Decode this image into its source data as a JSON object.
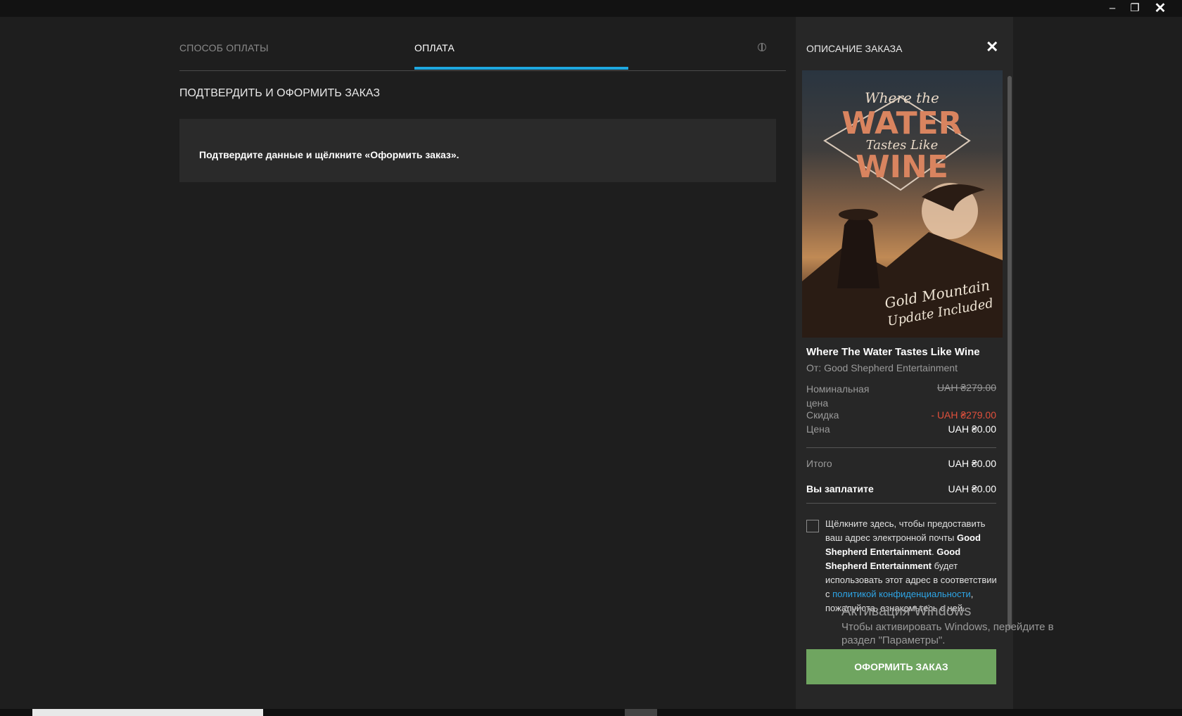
{
  "window": {
    "minimize_glyph": "–",
    "maximize_glyph": "❐",
    "close_glyph": "✕"
  },
  "tabs": [
    {
      "label": "СПОСОБ ОПЛАТЫ",
      "active": false
    },
    {
      "label": "ОПЛАТА",
      "active": true
    }
  ],
  "main": {
    "section_title": "ПОДТВЕРДИТЬ И ОФОРМИТЬ ЗАКАЗ",
    "notice": "Подтвердите данные и щёлкните «Оформить заказ»."
  },
  "order": {
    "title": "ОПИСАНИЕ ЗАКАЗА",
    "close_glyph": "✕",
    "cover": {
      "title_line1": "Where the",
      "title_line2": "WATER",
      "title_line3": "Tastes Like",
      "title_line4": "WINE",
      "badge_line1": "Gold Mountain",
      "badge_line2": "Update Included"
    },
    "game_title": "Where The Water Tastes Like Wine",
    "publisher": "От: Good Shepherd Entertainment",
    "nominal_label": "Номинальная цена",
    "nominal_value": "UAH ₴279.00",
    "discount_label": "Скидка",
    "discount_value": "- UAH ₴279.00",
    "price_label": "Цена",
    "price_value": "UAH ₴0.00",
    "subtotal_label": "Итого",
    "subtotal_value": "UAH ₴0.00",
    "pay_label": "Вы заплатите",
    "pay_value": "UAH ₴0.00",
    "consent": {
      "part1": "Щёлкните здесь, чтобы предоставить ваш адрес электронной почты ",
      "company1": "Good Shepherd Entertainment",
      "part2": ". ",
      "company2": "Good Shepherd Entertainment",
      "part3": " будет использовать этот адрес в соответствии с ",
      "link": "политикой конфиденциальности",
      "part4": ", пожалуйста, ознакомьтесь с ней."
    },
    "order_button": "ОФОРМИТЬ ЗАКАЗ"
  },
  "watermark": {
    "title": "Активация Windows",
    "text": "Чтобы активировать Windows, перейдите в раздел \"Параметры\"."
  },
  "colors": {
    "accent": "#1ea8e0",
    "button": "#6fa560",
    "discount": "#e0503c",
    "link": "#2ea5e6"
  }
}
